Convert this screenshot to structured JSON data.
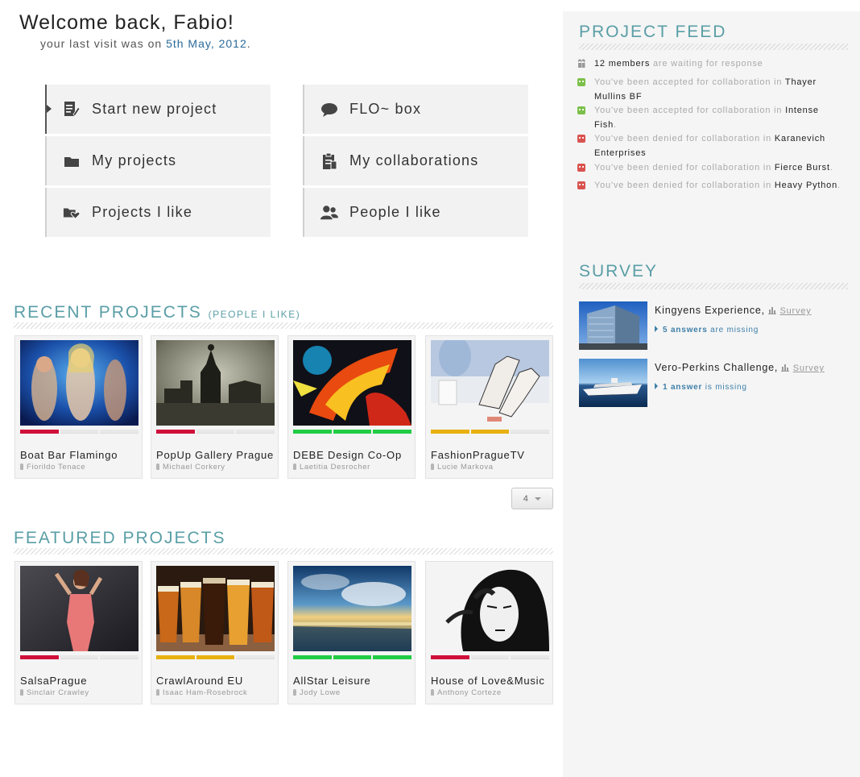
{
  "header": {
    "welcome": "Welcome back, Fabio!",
    "last_visit_prefix": "your last visit was on",
    "last_visit_date": "5th May, 2012",
    "last_visit_suffix": "."
  },
  "menu": [
    {
      "label": "Start new project",
      "icon": "edit-document-icon"
    },
    {
      "label": "FLO~ box",
      "icon": "speech-bubble-icon"
    },
    {
      "label": "My projects",
      "icon": "folder-icon"
    },
    {
      "label": "My collaborations",
      "icon": "clipboard-icon"
    },
    {
      "label": "Projects I like",
      "icon": "heart-folder-icon"
    },
    {
      "label": "People I like",
      "icon": "people-icon"
    }
  ],
  "recent": {
    "title": "RECENT PROJECTS",
    "subtitle": "(PEOPLE I LIKE)",
    "pager_value": "4",
    "cards": [
      {
        "name": "Boat Bar Flamingo",
        "owner": "Fiorildo Tenace",
        "progress": {
          "filled": 1,
          "total": 3,
          "color": "#d0103a"
        }
      },
      {
        "name": "PopUp Gallery Prague",
        "owner": "Michael Corkery",
        "progress": {
          "filled": 1,
          "total": 3,
          "color": "#d0103a"
        }
      },
      {
        "name": "DEBE Design Co-Op",
        "owner": "Laetitia Desrocher",
        "progress": {
          "filled": 3,
          "total": 3,
          "color": "#22cc44"
        }
      },
      {
        "name": "FashionPragueTV",
        "owner": "Lucie Markova",
        "progress": {
          "filled": 2,
          "total": 3,
          "color": "#e8b010"
        }
      }
    ]
  },
  "featured": {
    "title": "FEATURED PROJECTS",
    "cards": [
      {
        "name": "SalsaPrague",
        "owner": "Sinclair  Crawley",
        "progress": {
          "filled": 1,
          "total": 3,
          "color": "#d0103a"
        }
      },
      {
        "name": "CrawlAround EU",
        "owner": "Isaac Ham-Rosebrock",
        "progress": {
          "filled": 2,
          "total": 3,
          "color": "#e8b010"
        }
      },
      {
        "name": "AllStar Leisure",
        "owner": "Jody Lowe",
        "progress": {
          "filled": 3,
          "total": 3,
          "color": "#22cc44"
        }
      },
      {
        "name": "House of Love&Music",
        "owner": "Anthony Corteze",
        "progress": {
          "filled": 1,
          "total": 3,
          "color": "#d0103a"
        }
      }
    ]
  },
  "feed": {
    "title": "PROJECT FEED",
    "members_count": "12 members",
    "members_suffix": "are waiting for response",
    "items": [
      {
        "status": "accepted",
        "text": "You've been accepted for collaboration in",
        "project": "Thayer Mullins BF",
        "end": ""
      },
      {
        "status": "accepted",
        "text": "You've been accepted for collaboration in",
        "project": "Intense Fish",
        "end": "."
      },
      {
        "status": "denied",
        "text": "You've been denied for collaboration in",
        "project": "Karanevich Enterprises",
        "end": ""
      },
      {
        "status": "denied",
        "text": "You've been denied for collaboration in",
        "project": "Fierce Burst",
        "end": "."
      },
      {
        "status": "denied",
        "text": "You've been denied for collaboration in",
        "project": "Heavy Python",
        "end": "."
      }
    ]
  },
  "survey": {
    "title": "SURVEY",
    "items": [
      {
        "name": "Kingyens Experience,",
        "link": "Survey",
        "count": "5 answers",
        "status": "are missing"
      },
      {
        "name": "Vero-Perkins Challenge,",
        "link": "Survey",
        "count": "1 answer",
        "status": "is missing"
      }
    ]
  }
}
